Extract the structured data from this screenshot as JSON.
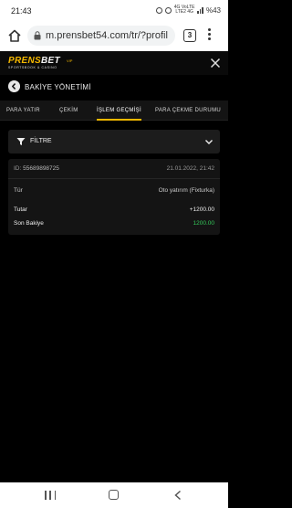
{
  "status_bar": {
    "time": "21:43",
    "battery": "%43",
    "network_top": "4G VoLTE",
    "network_bottom": "LTE2 4G"
  },
  "browser": {
    "url": "m.prensbet54.com/tr/?profil",
    "tab_count": "3"
  },
  "site": {
    "logo_text_a": "PRENS",
    "logo_text_b": "BET",
    "logo_tagline": "SPORTSBOOK & CASINO",
    "logo_badge": "VIP"
  },
  "page": {
    "title": "BAKİYE YÖNETİMİ",
    "tabs": [
      {
        "label": "PARA YATIR",
        "active": false
      },
      {
        "label": "ÇEKİM",
        "active": false
      },
      {
        "label": "İŞLEM GEÇMİŞİ",
        "active": true
      },
      {
        "label": "PARA ÇEKME DURUMU",
        "active": false
      }
    ],
    "filter_label": "FİLTRE"
  },
  "transaction": {
    "id_label": "ID:",
    "id_value": "55689898725",
    "datetime": "21.01.2022, 21:42",
    "type_label": "Tür",
    "type_value": "Oto yatırım (Fixturka)",
    "amount_label": "Tutar",
    "amount_value": "+1200.00",
    "balance_label": "Son Bakiye",
    "balance_value": "1200.00"
  },
  "colors": {
    "accent": "#f5b800",
    "positive": "#34c759",
    "background": "#000000",
    "card": "#141414"
  }
}
